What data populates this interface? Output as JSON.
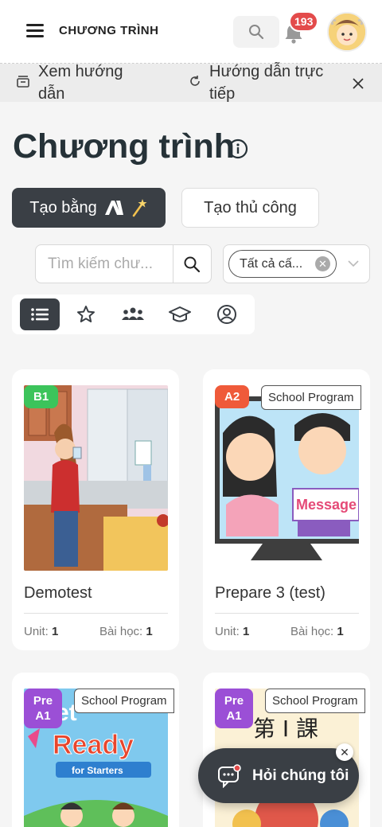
{
  "header": {
    "brand": "CHƯƠNG TRÌNH",
    "notification_count": "193",
    "icons": [
      "hamburger-icon",
      "search-icon",
      "bell-icon",
      "avatar"
    ]
  },
  "guide": {
    "view_guide": "Xem hướng dẫn",
    "live_guide": "Hướng dẫn trực tiếp"
  },
  "page": {
    "title": "Chương trình"
  },
  "actions": {
    "create_ai": "Tạo bằng",
    "create_manual": "Tạo thủ công"
  },
  "search": {
    "placeholder": "Tìm kiếm chư..."
  },
  "filter": {
    "selected": "Tất cả cấ..."
  },
  "view_tabs": [
    "list-icon",
    "star-icon",
    "group-icon",
    "graduation-cap-icon",
    "user-circle-icon"
  ],
  "cards": [
    {
      "level": "B1",
      "level_color": "#3cc45b",
      "badge": "",
      "name": "Demotest",
      "unit_label": "Unit:",
      "unit": "1",
      "lesson_label": "Bài học:",
      "lesson": "1"
    },
    {
      "level": "A2",
      "level_color": "#ef5a3a",
      "badge": "School Program",
      "name": "Prepare 3 (test)",
      "unit_label": "Unit:",
      "unit": "1",
      "lesson_label": "Bài học:",
      "lesson": "1"
    },
    {
      "level": "Pre A1",
      "level_color": "#9b4fd6",
      "badge": "School Program",
      "image_text": "Ready",
      "image_subtext": "for Starters"
    },
    {
      "level": "Pre A1",
      "level_color": "#9b4fd6",
      "badge": "School Program",
      "image_text": "第 I 課"
    }
  ],
  "chat": {
    "label": "Hỏi chúng tôi"
  },
  "colors": {
    "dark": "#3a3f45",
    "title": "#263238",
    "badge_red": "#e34b4b"
  }
}
